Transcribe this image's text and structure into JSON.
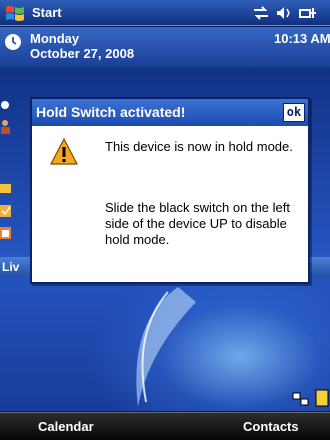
{
  "title_bar": {
    "title": "Start"
  },
  "today": {
    "day": "Monday",
    "date": "October 27, 2008",
    "time": "10:13 AM",
    "live_label": "Liv"
  },
  "dialog": {
    "title": "Hold Switch activated!",
    "ok_label": "ok",
    "message_1": "This device is now in hold mode.",
    "message_2": "Slide the black switch on the left side of the device UP to disable hold mode."
  },
  "softkeys": {
    "left": "Calendar",
    "right": "Contacts"
  },
  "colors": {
    "title_bar": "#1d4bb0",
    "dialog_title": "#2f63c8",
    "softkey_bar": "#111111"
  }
}
